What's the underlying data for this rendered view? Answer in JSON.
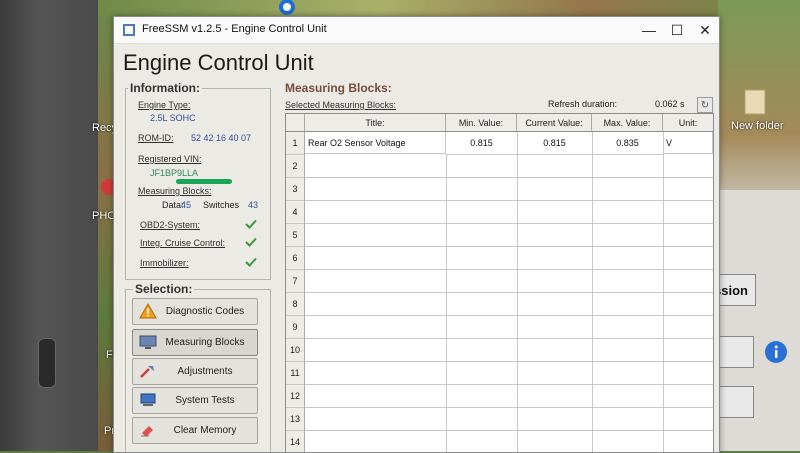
{
  "window": {
    "title": "FreeSSM v1.2.5 - Engine Control Unit",
    "controls": {
      "minimize": "—",
      "maximize": "☐",
      "close": "✕"
    }
  },
  "page_title": "Engine Control Unit",
  "information": {
    "heading": "Information:",
    "engine_type_label": "Engine Type:",
    "engine_type_value": "2.5L SOHC",
    "rom_id_label": "ROM-ID:",
    "rom_id_value": "52 42 16 40 07",
    "vin_label": "Registered VIN:",
    "vin_value": "JF1BP9LLA",
    "measuring_blocks_label": "Measuring Blocks:",
    "data_label": "Data:",
    "data_value": "45",
    "switches_label": "Switches",
    "switches_value": "43",
    "obd2_label": "OBD2-System:",
    "cruise_label": "Integ. Cruise Control:",
    "immobilizer_label": "Immobilizer:",
    "check_color": "#3a9a3a"
  },
  "selection": {
    "heading": "Selection:",
    "buttons": [
      {
        "label": "Diagnostic Codes",
        "icon": "warning-icon"
      },
      {
        "label": "Measuring Blocks",
        "icon": "monitor-icon"
      },
      {
        "label": "Adjustments",
        "icon": "wrench-icon"
      },
      {
        "label": "System Tests",
        "icon": "computer-icon"
      },
      {
        "label": "Clear Memory",
        "icon": "eraser-icon"
      }
    ]
  },
  "measuring_blocks": {
    "heading": "Measuring Blocks:",
    "selected_label": "Selected Measuring Blocks:",
    "refresh_label": "Refresh duration:",
    "refresh_value": "0.062 s",
    "columns": [
      "Title:",
      "Min. Value:",
      "Current Value:",
      "Max. Value:",
      "Unit:"
    ],
    "row_numbers": [
      "1",
      "2",
      "3",
      "4",
      "5",
      "6",
      "7",
      "8",
      "9",
      "10",
      "11",
      "12",
      "13",
      "14"
    ],
    "rows": [
      {
        "title": "Rear O2 Sensor Voltage",
        "min": "0.815",
        "current": "0.815",
        "max": "0.835",
        "unit": "V"
      }
    ]
  },
  "desktop": {
    "labels": [
      "Recy",
      "New folder",
      "PHOTO",
      "Fre",
      "Pro",
      "ssion"
    ]
  }
}
